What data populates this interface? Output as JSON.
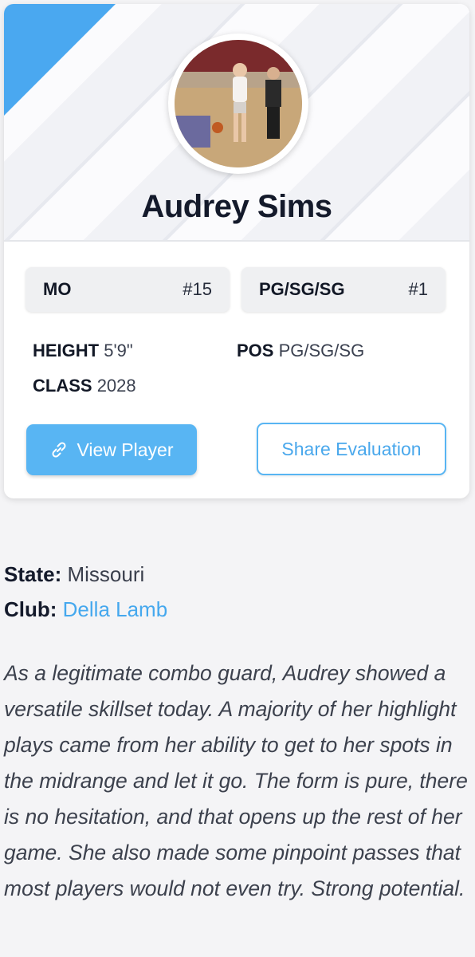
{
  "player": {
    "name": "Audrey Sims",
    "photo_alt": "player-photo"
  },
  "badges": {
    "state": {
      "label": "MO",
      "rank": "#15"
    },
    "position": {
      "label": "PG/SG/SG",
      "rank": "#1"
    }
  },
  "attributes": {
    "height": {
      "key": "HEIGHT",
      "value": "5'9\""
    },
    "class": {
      "key": "CLASS",
      "value": "2028"
    },
    "pos": {
      "key": "POS",
      "value": "PG/SG/SG"
    }
  },
  "actions": {
    "view_player": "View Player",
    "share_evaluation": "Share Evaluation"
  },
  "details": {
    "state_key": "State:",
    "state_value": "Missouri",
    "club_key": "Club:",
    "club_value": "Della Lamb"
  },
  "evaluation": "As a legitimate combo guard, Audrey showed a versatile skillset today. A majority of her highlight plays came from her ability to get to her spots in the midrange and let it go. The form is pure, there is no hesitation, and that opens up the rest of her game. She also made some pinpoint passes that most players would not even try. Strong potential.",
  "colors": {
    "accent": "#58b5f3",
    "link": "#45a8ee",
    "flag": "#4aa8f0"
  },
  "icons": {
    "view_player": "link-icon"
  }
}
